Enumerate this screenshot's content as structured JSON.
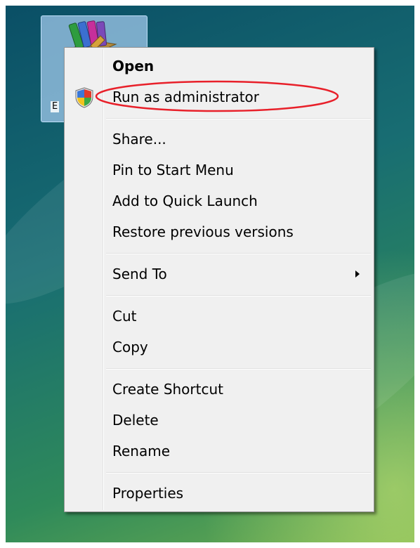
{
  "desktop": {
    "icon_label": "E",
    "icon_name": "books-archive-icon"
  },
  "context_menu": {
    "items": [
      {
        "label": "Open",
        "bold": true
      },
      {
        "label": "Run as administrator",
        "icon": "uac-shield-icon",
        "highlighted": true
      },
      {
        "label": "Share..."
      },
      {
        "label": "Pin to Start Menu"
      },
      {
        "label": "Add to Quick Launch"
      },
      {
        "label": "Restore previous versions"
      },
      {
        "label": "Send To",
        "has_submenu": true
      },
      {
        "label": "Cut"
      },
      {
        "label": "Copy"
      },
      {
        "label": "Create Shortcut"
      },
      {
        "label": "Delete"
      },
      {
        "label": "Rename"
      },
      {
        "label": "Properties"
      }
    ]
  },
  "colors": {
    "menu_background": "#f0f0f0",
    "highlight_ellipse": "#e8202a",
    "desktop_top": "#0a4f66",
    "desktop_bottom": "#6fae4e"
  }
}
